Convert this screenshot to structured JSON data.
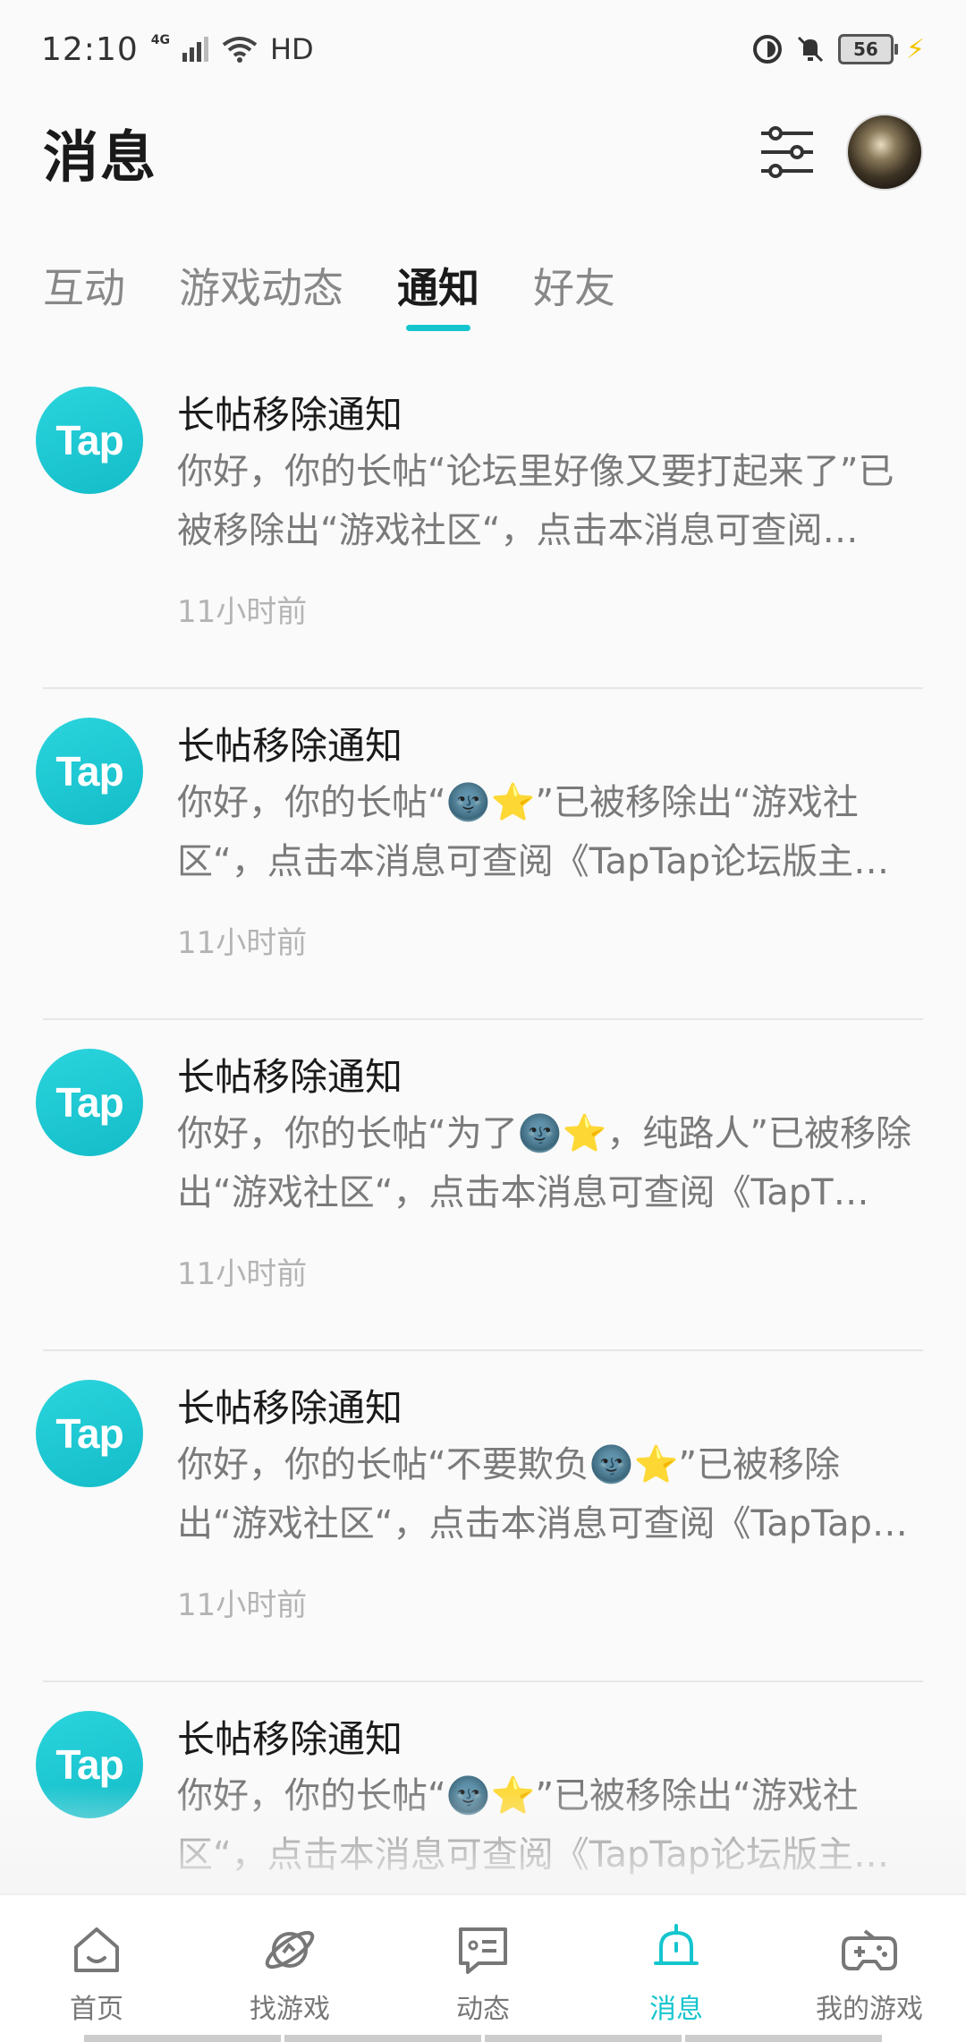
{
  "status_bar": {
    "time": "12:10",
    "network": "4G",
    "hd": "HD",
    "battery": "56"
  },
  "header": {
    "title": "消息",
    "filter_icon": "sliders-icon",
    "avatar_icon": "avatar"
  },
  "tabs": [
    {
      "label": "互动"
    },
    {
      "label": "游戏动态"
    },
    {
      "label": "通知"
    },
    {
      "label": "好友"
    }
  ],
  "active_tab": "通知",
  "notifications": [
    {
      "logo": "Tap",
      "title": "长帖移除通知",
      "body": "你好，你的长帖“论坛里好像又要打起来了”已被移除出“游戏社区“，点击本消息可查阅《TapTap论坛版主…",
      "time": "11小时前"
    },
    {
      "logo": "Tap",
      "title": "长帖移除通知",
      "body": "你好，你的长帖“🌚⭐”已被移除出“游戏社区“，点击本消息可查阅《TapTap论坛版主…",
      "time": "11小时前"
    },
    {
      "logo": "Tap",
      "title": "长帖移除通知",
      "body": "你好，你的长帖“为了🌚⭐，纯路人”已被移除出“游戏社区“，点击本消息可查阅《TapT…",
      "time": "11小时前"
    },
    {
      "logo": "Tap",
      "title": "长帖移除通知",
      "body": "你好，你的长帖“不要欺负🌚⭐”已被移除出“游戏社区“，点击本消息可查阅《TapTap…",
      "time": "11小时前"
    },
    {
      "logo": "Tap",
      "title": "长帖移除通知",
      "body": "你好，你的长帖“🌚⭐”已被移除出“游戏社区“，点击本消息可查阅《TapTap论坛版主…",
      "time": ""
    }
  ],
  "bottom_nav": [
    {
      "label": "首页",
      "icon": "home-icon"
    },
    {
      "label": "找游戏",
      "icon": "planet-icon"
    },
    {
      "label": "动态",
      "icon": "feed-icon"
    },
    {
      "label": "消息",
      "icon": "bell-icon"
    },
    {
      "label": "我的游戏",
      "icon": "gamepad-icon"
    }
  ],
  "colors": {
    "accent": "#15c5ce"
  }
}
